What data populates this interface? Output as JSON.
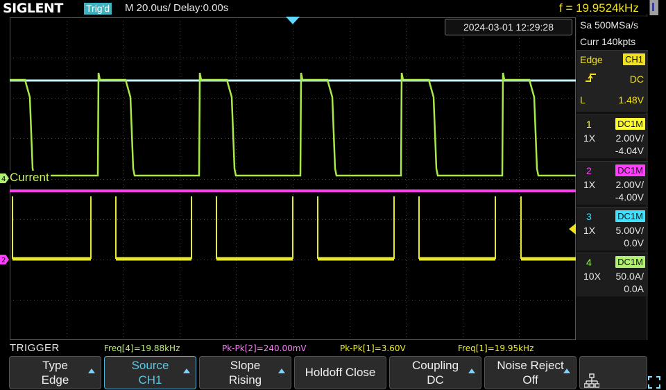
{
  "header": {
    "brand": "SIGLENT",
    "trig_status": "Trig'd",
    "timebase": "M 20.0us/",
    "delay": "Delay:0.00s",
    "frequency": "f = 19.9524kHz",
    "datetime": "2024-03-01 12:29:28"
  },
  "acquisition": {
    "sample_rate": "Sa 500MSa/s",
    "memory": "Curr 140kpts"
  },
  "trigger_panel": {
    "type": "Edge",
    "source": "CH1",
    "slope_symbol": "rising-edge",
    "coupling": "DC",
    "level_label": "L",
    "level": "1.48V"
  },
  "channels": [
    {
      "num": "1",
      "coupling": "DC1M",
      "probe": "1X",
      "scale": "2.00V/",
      "offset": "-4.04V",
      "color": "#ffff30"
    },
    {
      "num": "2",
      "coupling": "DC1M",
      "probe": "1X",
      "scale": "2.00V/",
      "offset": "-4.00V",
      "color": "#ff40ff"
    },
    {
      "num": "3",
      "coupling": "DC1M",
      "probe": "1X",
      "scale": "5.00V/",
      "offset": "0.0V",
      "color": "#40e0ff"
    },
    {
      "num": "4",
      "coupling": "DC1M",
      "probe": "10X",
      "scale": "50.0A/",
      "offset": "0.0A",
      "color": "#b0f070"
    }
  ],
  "waveform_labels": {
    "ch4_label": "Current",
    "ch4_marker": "4",
    "ch2_marker": "2"
  },
  "measurements": {
    "section_label": "TRIGGER",
    "items": [
      {
        "text": "Freq[4]=19.88kHz",
        "color": "#b6f06a"
      },
      {
        "text": "Pk-Pk[2]=240.00mV",
        "color": "#ff7cff"
      },
      {
        "text": "Pk-Pk[1]=3.60V",
        "color": "#f0f020"
      },
      {
        "text": "Freq[1]=19.95kHz",
        "color": "#f0f020"
      }
    ]
  },
  "softkeys": [
    {
      "line1": "Type",
      "line2": "Edge",
      "arrow": true
    },
    {
      "line1": "Source",
      "line2": "CH1",
      "arrow": true,
      "active": true
    },
    {
      "line1": "Slope",
      "line2": "Rising",
      "arrow": true
    },
    {
      "line1": "Holdoff Close",
      "line2": "",
      "arrow": false
    },
    {
      "line1": "Coupling",
      "line2": "DC",
      "arrow": true
    },
    {
      "line1": "Noise Reject",
      "line2": "Off",
      "arrow": true
    }
  ],
  "icons": {
    "network": "network-icon",
    "fullscreen": "fullscreen-icon",
    "trigger_position": "trigger-position-marker",
    "trigger_level": "trigger-level-marker"
  }
}
